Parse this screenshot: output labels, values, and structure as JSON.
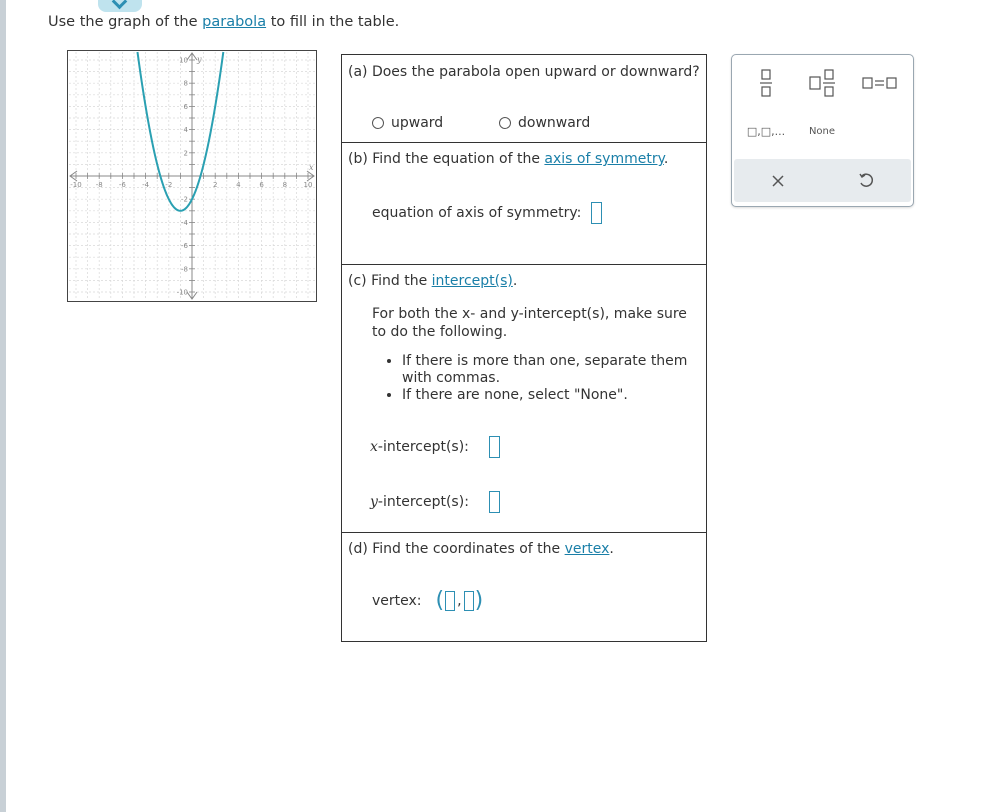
{
  "prompt": {
    "before": "Use the graph of the ",
    "link": "parabola",
    "after": " to fill in the table."
  },
  "graph": {
    "x_label": "x",
    "y_label": "y",
    "x_ticks": [
      "-10",
      "-8",
      "-6",
      "-4",
      "-2",
      "2",
      "4",
      "6",
      "8",
      "10"
    ],
    "y_ticks": [
      "10",
      "8",
      "6",
      "4",
      "2",
      "-2",
      "-4",
      "-6",
      "-8",
      "-10"
    ],
    "curve_color": "#2aa0b2",
    "vertex": [
      -1,
      -3
    ],
    "a": 1
  },
  "part_a": {
    "question": "(a) Does the parabola open upward or downward?",
    "options": [
      "upward",
      "downward"
    ]
  },
  "part_b": {
    "question_before": "(b) Find the equation of the ",
    "question_link": "axis of symmetry",
    "question_after": ".",
    "field_label": "equation of axis of symmetry:"
  },
  "part_c": {
    "question_before": "(c) Find the ",
    "question_link": "intercept(s)",
    "question_after": ".",
    "instruction": "For both the x- and y-intercept(s), make sure to do the following.",
    "bullets": [
      "If there is more than one, separate them with commas.",
      "If there are none, select \"None\"."
    ],
    "x_label_var": "x",
    "x_label_rest": "-intercept(s):",
    "y_label_var": "y",
    "y_label_rest": "-intercept(s):"
  },
  "part_d": {
    "question_before": "(d) Find the coordinates of the ",
    "question_link": "vertex",
    "question_after": ".",
    "field_label": "vertex:"
  },
  "toolbox": {
    "list_label": "□,□,...",
    "none_label": "None",
    "accent": "#2d8fb3"
  }
}
